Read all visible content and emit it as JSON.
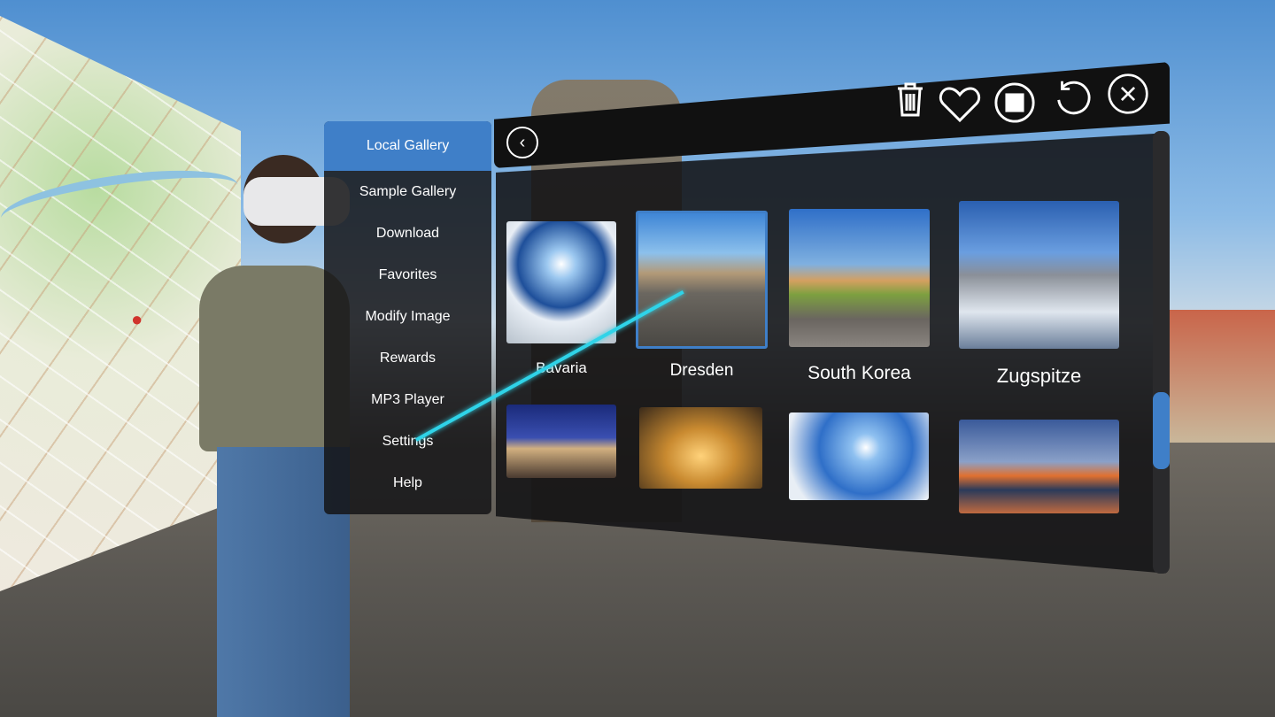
{
  "menu": {
    "items": [
      {
        "label": "Local Gallery",
        "active": true
      },
      {
        "label": "Sample Gallery"
      },
      {
        "label": "Download"
      },
      {
        "label": "Favorites"
      },
      {
        "label": "Modify Image"
      },
      {
        "label": "Rewards"
      },
      {
        "label": "MP3 Player"
      },
      {
        "label": "Settings"
      },
      {
        "label": "Help"
      }
    ]
  },
  "toolbar": {
    "icons": [
      "trash-icon",
      "heart-icon",
      "stop-icon",
      "undo-icon",
      "close-icon"
    ],
    "back_icon": "chevron-left-icon"
  },
  "gallery": {
    "items": [
      {
        "label": "Bavaria"
      },
      {
        "label": "Dresden",
        "selected": true
      },
      {
        "label": "South Korea"
      },
      {
        "label": "Zugspitze"
      },
      {
        "label": ""
      },
      {
        "label": ""
      },
      {
        "label": ""
      },
      {
        "label": ""
      }
    ]
  },
  "accent_color": "#3f7fc8",
  "laser_color": "#2fd3e8",
  "scroll_position_fraction": 0.65
}
